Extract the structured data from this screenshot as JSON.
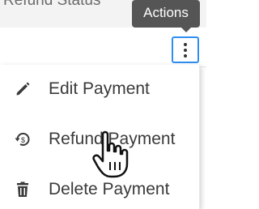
{
  "table": {
    "header_label": "Refund Status"
  },
  "tooltip": {
    "text": "Actions"
  },
  "actions_button": {
    "icon": "kebab-vertical-icon",
    "border_color": "#2f8ef0"
  },
  "menu": {
    "items": [
      {
        "label": "Edit Payment",
        "icon": "pencil-icon"
      },
      {
        "label": "Refund Payment",
        "icon": "refund-icon"
      },
      {
        "label": "Delete Payment",
        "icon": "trash-icon"
      }
    ]
  },
  "cursor": {
    "icon": "hand-pointer-icon"
  }
}
